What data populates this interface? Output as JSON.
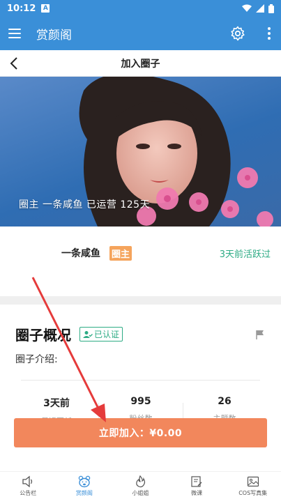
{
  "status_bar": {
    "time": "10:12",
    "badge": "A"
  },
  "app_bar": {
    "title": "赏颜阁"
  },
  "nav_bar": {
    "title": "加入圈子"
  },
  "hero": {
    "caption": "圈主  一条咸鱼  已运营  125天"
  },
  "owner": {
    "name": "一条咸鱼",
    "badge": "圈主",
    "active": "3天前活跃过"
  },
  "overview": {
    "title": "圈子概况",
    "verified": "已认证",
    "intro_label": "圈子介绍:",
    "stats": [
      {
        "value": "3天前",
        "label": "最近更新"
      },
      {
        "value": "995",
        "label": "粉丝数"
      },
      {
        "value": "26",
        "label": "主题数"
      }
    ]
  },
  "join_button": {
    "label": "立即加入：¥0.00"
  },
  "colors": {
    "primary": "#3a8fd8",
    "accent_orange": "#f2875c",
    "green": "#2dab84",
    "badge_orange": "#f5a45c"
  },
  "bottom_nav": [
    {
      "label": "公告栏",
      "icon": "speaker-icon",
      "active": false
    },
    {
      "label": "赏颜阁",
      "icon": "bear-icon",
      "active": true
    },
    {
      "label": "小姐姐",
      "icon": "flame-icon",
      "active": false
    },
    {
      "label": "微课",
      "icon": "edit-doc-icon",
      "active": false
    },
    {
      "label": "COS写真集",
      "icon": "photo-icon",
      "active": false
    }
  ]
}
